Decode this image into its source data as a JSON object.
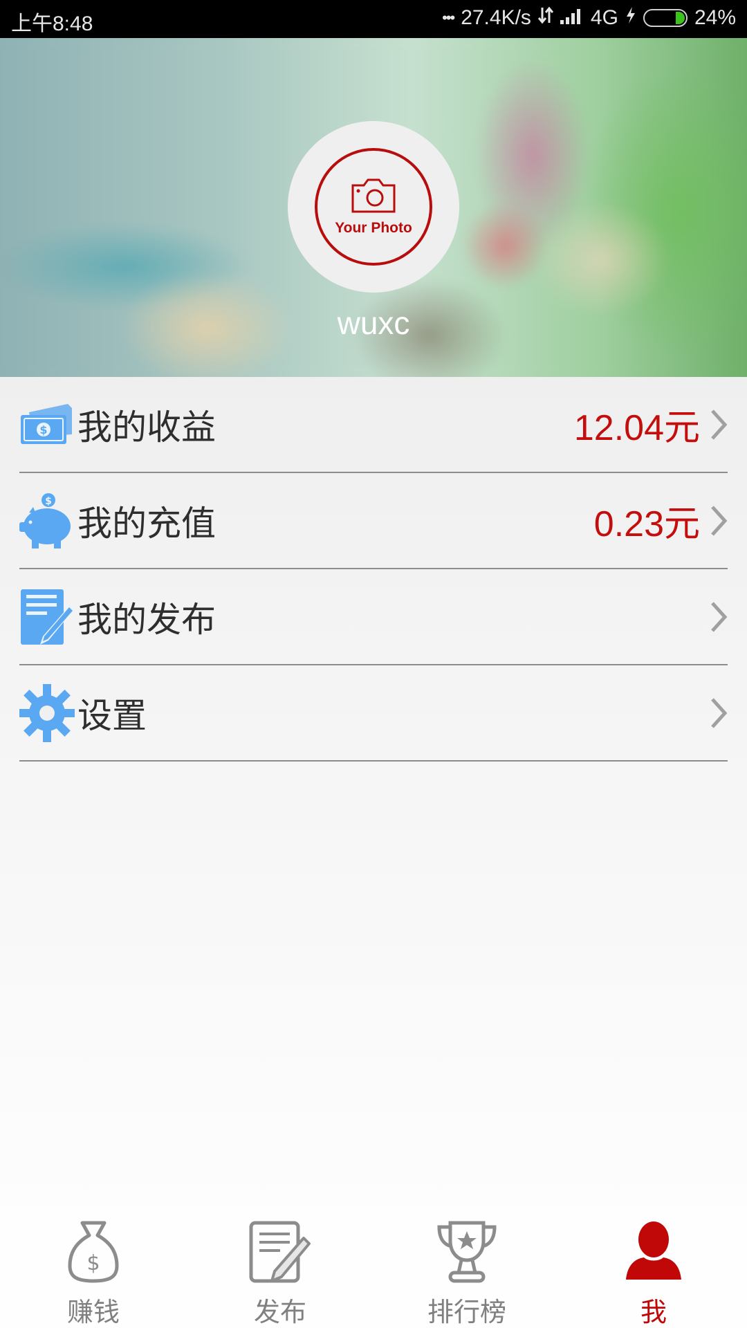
{
  "status_bar": {
    "time": "上午8:48",
    "more": "•••",
    "network_speed": "27.4K/s",
    "network_type": "4G",
    "battery_percent": "24%",
    "battery_level": 0.24
  },
  "profile": {
    "avatar_placeholder_label": "Your Photo",
    "username": "wuxc"
  },
  "menu": {
    "items": [
      {
        "label": "我的收益",
        "value": "12.04元",
        "icon": "money-icon"
      },
      {
        "label": "我的充值",
        "value": "0.23元",
        "icon": "piggy-bank-icon"
      },
      {
        "label": "我的发布",
        "value": "",
        "icon": "edit-document-icon"
      },
      {
        "label": "设置",
        "value": "",
        "icon": "gear-icon"
      }
    ]
  },
  "tabbar": {
    "tabs": [
      {
        "label": "赚钱",
        "icon": "money-bag-icon",
        "active": false
      },
      {
        "label": "发布",
        "icon": "edit-document-icon",
        "active": false
      },
      {
        "label": "排行榜",
        "icon": "trophy-icon",
        "active": false
      },
      {
        "label": "我",
        "icon": "user-icon",
        "active": true
      }
    ]
  },
  "colors": {
    "accent_red": "#c40e0e",
    "icon_blue": "#5aa8f2",
    "inactive_gray": "#808080"
  }
}
